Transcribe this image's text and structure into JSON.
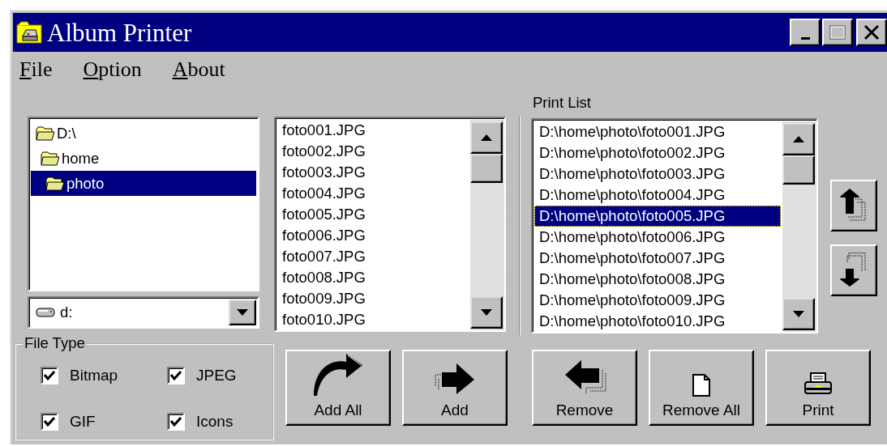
{
  "window": {
    "title": "Album Printer"
  },
  "menu": [
    {
      "label": "File",
      "mnemonic_underlined": true
    },
    {
      "label": "Option",
      "mnemonic_underlined": true
    },
    {
      "label": "About",
      "mnemonic_underlined": true
    }
  ],
  "folder_tree": {
    "items": [
      {
        "label": "D:\\",
        "selected": false,
        "children": [
          {
            "label": "home",
            "selected": false,
            "children": [
              {
                "label": "photo",
                "selected": true
              }
            ]
          }
        ]
      }
    ]
  },
  "drive_select": {
    "value": "d:"
  },
  "file_list": {
    "items": [
      {
        "label": "foto001.JPG",
        "selected": false
      },
      {
        "label": "foto002.JPG",
        "selected": false
      },
      {
        "label": "foto003.JPG",
        "selected": false
      },
      {
        "label": "foto004.JPG",
        "selected": false
      },
      {
        "label": "foto005.JPG",
        "selected": false
      },
      {
        "label": "foto006.JPG",
        "selected": false
      },
      {
        "label": "foto007.JPG",
        "selected": false
      },
      {
        "label": "foto008.JPG",
        "selected": false
      },
      {
        "label": "foto009.JPG",
        "selected": false
      },
      {
        "label": "foto010.JPG",
        "selected": false
      }
    ]
  },
  "print_list": {
    "label": "Print List",
    "items": [
      {
        "label": "D:\\home\\photo\\foto001.JPG",
        "selected": false
      },
      {
        "label": "D:\\home\\photo\\foto002.JPG",
        "selected": false
      },
      {
        "label": "D:\\home\\photo\\foto003.JPG",
        "selected": false
      },
      {
        "label": "D:\\home\\photo\\foto004.JPG",
        "selected": false
      },
      {
        "label": "D:\\home\\photo\\foto005.JPG",
        "selected": true
      },
      {
        "label": "D:\\home\\photo\\foto006.JPG",
        "selected": false
      },
      {
        "label": "D:\\home\\photo\\foto007.JPG",
        "selected": false
      },
      {
        "label": "D:\\home\\photo\\foto008.JPG",
        "selected": false
      },
      {
        "label": "D:\\home\\photo\\foto009.JPG",
        "selected": false
      },
      {
        "label": "D:\\home\\photo\\foto010.JPG",
        "selected": false
      }
    ]
  },
  "file_type": {
    "label": "File Type",
    "options": [
      {
        "label": "Bitmap",
        "checked": true
      },
      {
        "label": "JPEG",
        "checked": true
      },
      {
        "label": "GIF",
        "checked": true
      },
      {
        "label": "Icons",
        "checked": true
      }
    ]
  },
  "buttons": [
    {
      "label": "Add All",
      "kind": "add-all"
    },
    {
      "label": "Add",
      "kind": "add"
    },
    {
      "label": "Remove",
      "kind": "remove"
    },
    {
      "label": "Remove All",
      "kind": "remove-all"
    },
    {
      "label": "Print",
      "kind": "print"
    }
  ]
}
